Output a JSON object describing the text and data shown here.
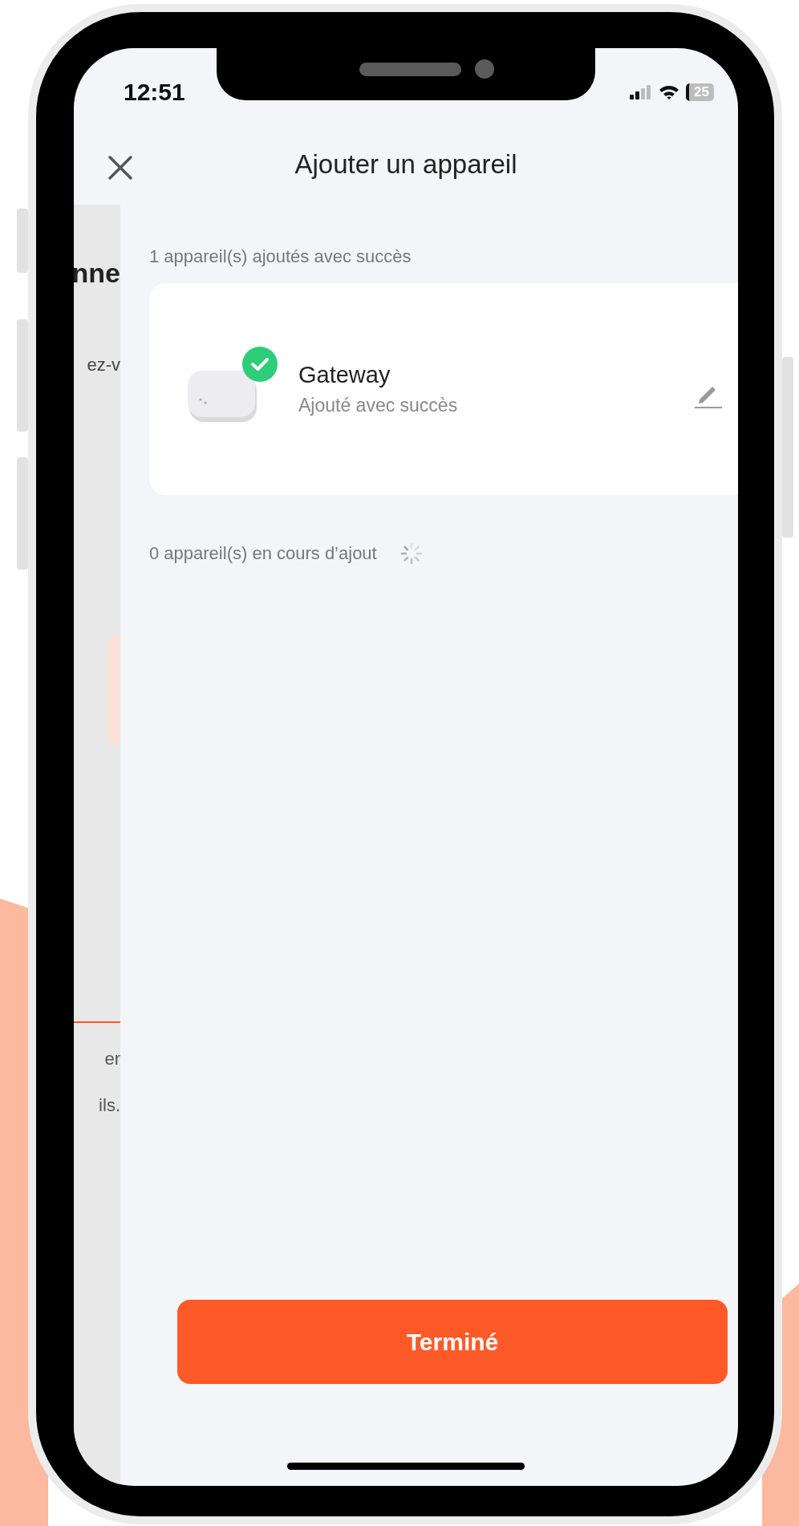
{
  "status_bar": {
    "time": "12:51",
    "battery": "25"
  },
  "header": {
    "title": "Ajouter un appareil"
  },
  "background_page": {
    "texts": [
      {
        "kind": "heading",
        "text": "nne"
      },
      {
        "kind": "body",
        "text": "ez-v"
      },
      {
        "kind": "footer",
        "text": "er"
      },
      {
        "kind": "footer",
        "text": "ils."
      }
    ]
  },
  "added_section": {
    "label": "1 appareil(s) ajoutés avec succès",
    "devices": [
      {
        "name": "Gateway",
        "status": "Ajouté avec succès",
        "added": true
      }
    ]
  },
  "pending_section": {
    "label": "0 appareil(s) en cours d’ajout",
    "loading": true
  },
  "done_button": {
    "label": "Terminé"
  }
}
